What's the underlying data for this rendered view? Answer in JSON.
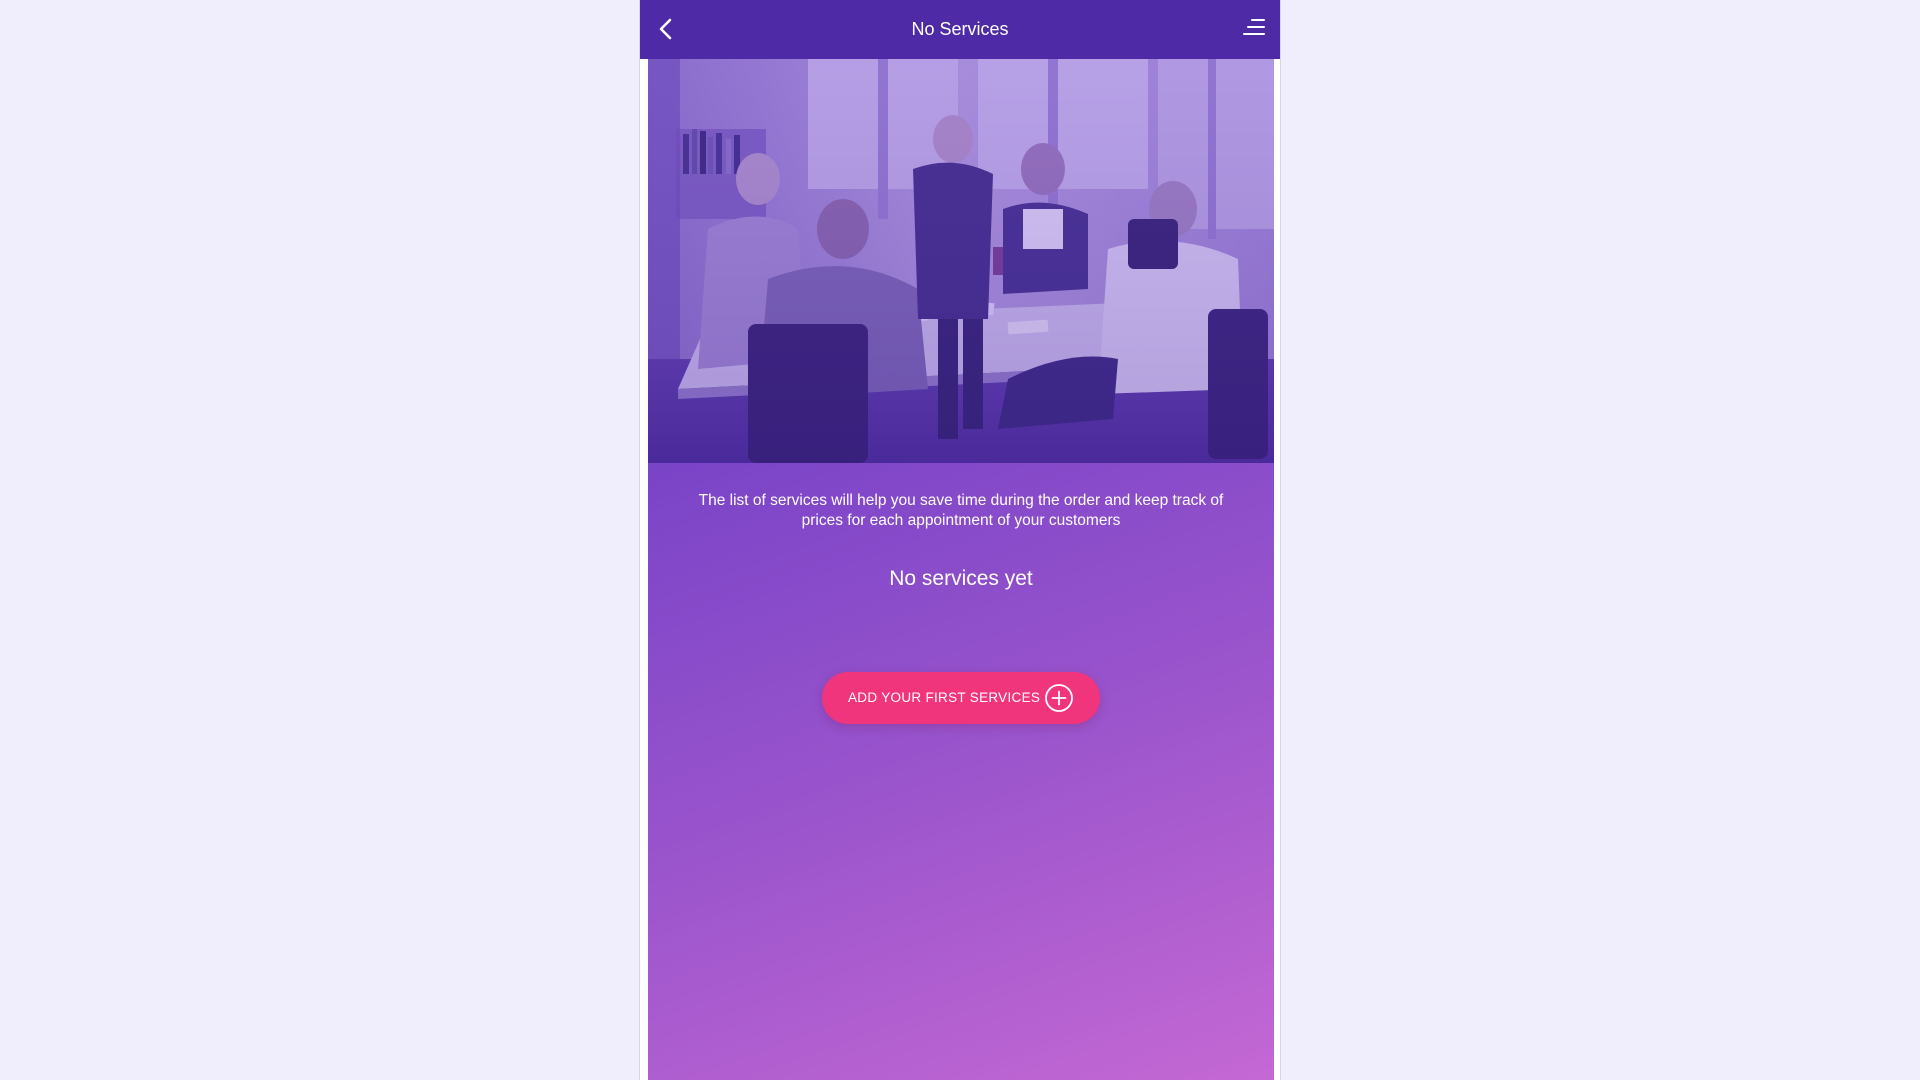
{
  "header": {
    "title": "No Services",
    "back_icon": "chevron-left-icon",
    "menu_icon": "menu-icon"
  },
  "hero": {
    "image": "team-meeting-photo"
  },
  "empty_state": {
    "description": "The list of services will help you save time during the order and keep track of prices for each appointment of your customers",
    "title": "No services yet",
    "add_button_label": "ADD YOUR FIRST SERVICES",
    "add_button_icon": "plus-circle-icon"
  },
  "colors": {
    "header_bg": "#4f2aa6",
    "gradient_start": "#5b34bb",
    "gradient_end": "#c468d4",
    "button_bg": "#f0357c",
    "page_bg": "#f0eefc"
  }
}
